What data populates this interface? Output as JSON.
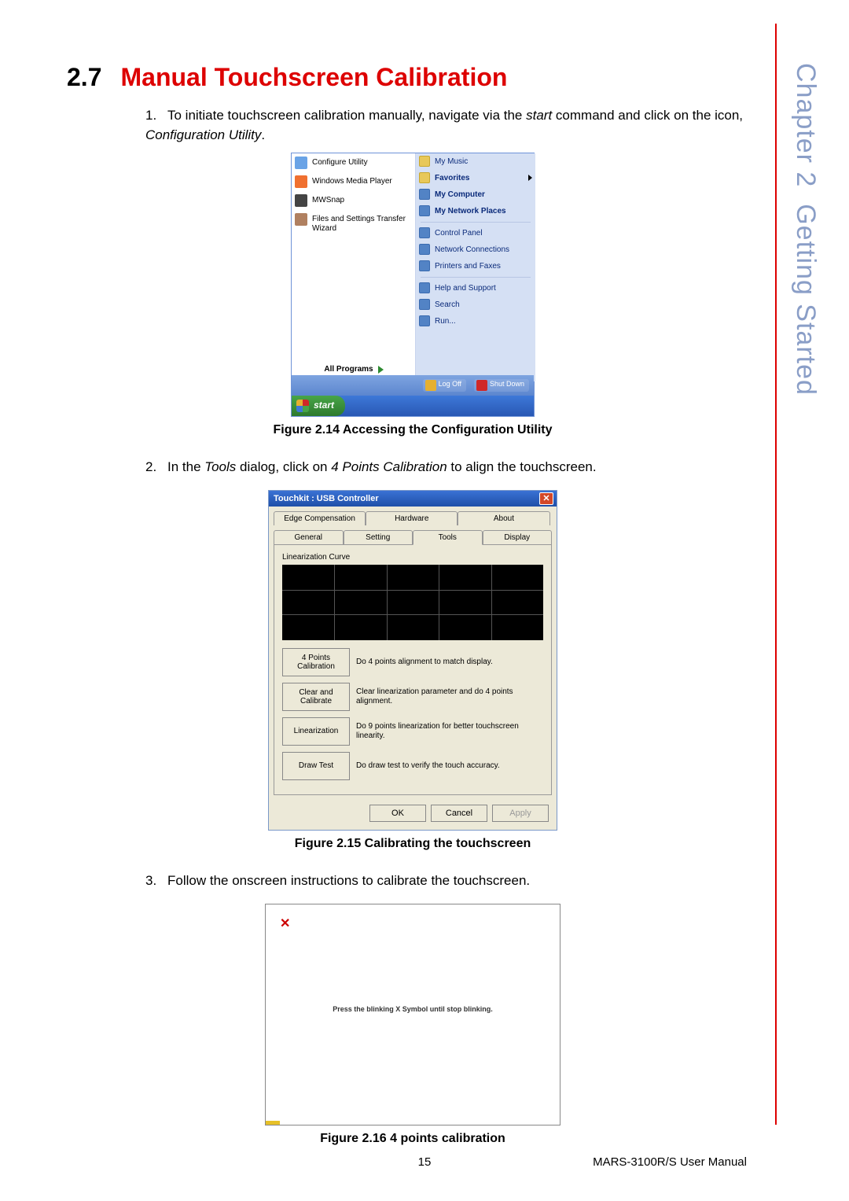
{
  "side": {
    "chapter": "Chapter 2",
    "title": "Getting Started"
  },
  "heading": {
    "number": "2.7",
    "title": "Manual Touchscreen Calibration"
  },
  "steps": {
    "s1_n": "1.",
    "s1_a": "To initiate touchscreen calibration manually, navigate via the ",
    "s1_b": "start",
    "s1_c": " command and click on the icon, ",
    "s1_d": "Configuration Utility",
    "s1_e": ".",
    "s2_n": "2.",
    "s2_a": "In the ",
    "s2_b": "Tools",
    "s2_c": " dialog, click on ",
    "s2_d": "4 Points Calibration",
    "s2_e": " to align the touchscreen.",
    "s3_n": "3.",
    "s3": "Follow the onscreen instructions to calibrate the touchscreen."
  },
  "captions": {
    "f1": "Figure 2.14 Accessing the Configuration Utility",
    "f2": "Figure 2.15 Calibrating the touchscreen",
    "f3": "Figure 2.16 4 points calibration"
  },
  "fig1": {
    "left": {
      "configure": "Configure Utility",
      "wmp": "Windows Media Player",
      "mwsnap": "MWSnap",
      "fst": "Files and Settings Transfer Wizard",
      "all": "All Programs"
    },
    "right": {
      "music": "My Music",
      "fav": "Favorites",
      "comp": "My Computer",
      "net": "My Network Places",
      "cpl": "Control Panel",
      "netconn": "Network Connections",
      "printers": "Printers and Faxes",
      "help": "Help and Support",
      "search": "Search",
      "run": "Run..."
    },
    "bottom": {
      "logoff": "Log Off",
      "shut": "Shut Down"
    },
    "startbar": {
      "start": "start"
    }
  },
  "fig2": {
    "title": "Touchkit : USB Controller",
    "tabs_row1": {
      "edge": "Edge Compensation",
      "hw": "Hardware",
      "about": "About"
    },
    "tabs_row2": {
      "gen": "General",
      "set": "Setting",
      "tools": "Tools",
      "disp": "Display"
    },
    "curve_label": "Linearization Curve",
    "rows": {
      "b1": "4 Points Calibration",
      "d1": "Do 4 points alignment to match display.",
      "b2": "Clear and Calibrate",
      "d2": "Clear linearization parameter and do 4 points alignment.",
      "b3": "Linearization",
      "d3": "Do 9 points linearization for better touchscreen linearity.",
      "b4": "Draw Test",
      "d4": "Do draw test to verify the touch accuracy."
    },
    "buttons": {
      "ok": "OK",
      "cancel": "Cancel",
      "apply": "Apply"
    }
  },
  "fig3": {
    "x": "✕",
    "msg": "Press the blinking X Symbol until stop blinking."
  },
  "footer": {
    "page": "15",
    "manual": "MARS-3100R/S User Manual"
  }
}
